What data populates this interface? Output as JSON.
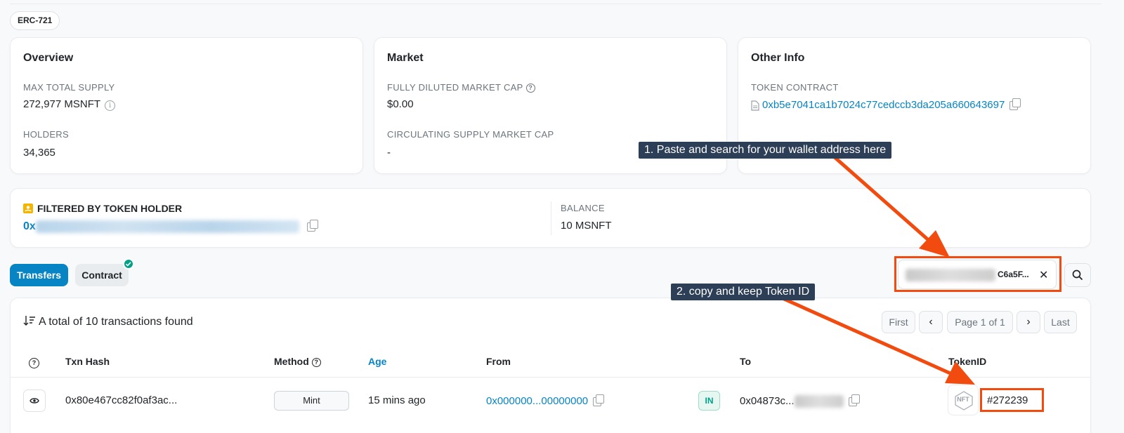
{
  "token_standard": "ERC-721",
  "overview": {
    "title": "Overview",
    "max_supply_label": "MAX TOTAL SUPPLY",
    "max_supply_value": "272,977 MSNFT",
    "holders_label": "HOLDERS",
    "holders_value": "34,365"
  },
  "market": {
    "title": "Market",
    "fdmc_label": "FULLY DILUTED MARKET CAP",
    "fdmc_value": "$0.00",
    "csmc_label": "CIRCULATING SUPPLY MARKET CAP",
    "csmc_value": "-"
  },
  "other_info": {
    "title": "Other Info",
    "contract_label": "TOKEN CONTRACT",
    "contract_value": "0xb5e7041ca1b7024c77cedccb3da205a660643697"
  },
  "filter": {
    "label": "FILTERED BY TOKEN HOLDER",
    "address_prefix": "0x",
    "balance_label": "BALANCE",
    "balance_value": "10 MSNFT"
  },
  "tabs": [
    {
      "label": "Transfers",
      "active": true
    },
    {
      "label": "Contract",
      "verified": true
    }
  ],
  "search": {
    "value_suffix": "C6a5F..."
  },
  "results": {
    "summary": "A total of 10 transactions found",
    "pager": {
      "first": "First",
      "page": "Page 1 of 1",
      "last": "Last"
    }
  },
  "table": {
    "headers": {
      "txn_hash": "Txn Hash",
      "method": "Method",
      "age": "Age",
      "from": "From",
      "to": "To",
      "token_id": "TokenID"
    },
    "rows": [
      {
        "txn_hash": "0x80e467cc82f0af3ac...",
        "method": "Mint",
        "age": "15 mins ago",
        "from": "0x000000...00000000",
        "direction": "IN",
        "to_prefix": "0x04873c...",
        "nft_badge": "NFT",
        "token_id": "#272239"
      }
    ]
  },
  "annotations": {
    "step1": "1. Paste and search for your wallet address here",
    "step2": "2. copy and keep Token ID"
  },
  "colors": {
    "link": "#0784c3",
    "primary": "#0784c3",
    "annotation": "#f24b0f",
    "callout_bg": "#2d3e57"
  }
}
